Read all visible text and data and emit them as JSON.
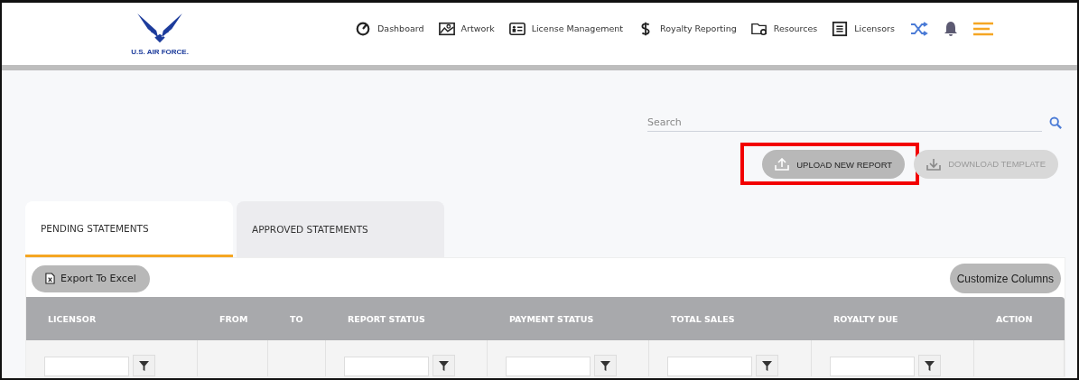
{
  "logo": {
    "text": "U.S. AIR FORCE."
  },
  "nav": [
    {
      "label": "Dashboard"
    },
    {
      "label": "Artwork"
    },
    {
      "label": "License Management"
    },
    {
      "label": "Royalty Reporting"
    },
    {
      "label": "Resources"
    },
    {
      "label": "Licensors"
    }
  ],
  "search": {
    "placeholder": "Search"
  },
  "actions": [
    {
      "label": "UPLOAD NEW REPORT",
      "disabled": false,
      "highlighted": true
    },
    {
      "label": "DOWNLOAD TEMPLATE",
      "disabled": true,
      "highlighted": false
    }
  ],
  "tabs": [
    {
      "label": "PENDING STATEMENTS",
      "selected": true
    },
    {
      "label": "APPROVED STATEMENTS",
      "selected": false
    }
  ],
  "toolbar": {
    "export": "Export To Excel",
    "customize": "Customize Columns"
  },
  "table": {
    "columns": [
      {
        "label": "LICENSOR",
        "filter": true
      },
      {
        "label": "FROM",
        "filter": false
      },
      {
        "label": "TO",
        "filter": false
      },
      {
        "label": "REPORT STATUS",
        "filter": true
      },
      {
        "label": "PAYMENT STATUS",
        "filter": true
      },
      {
        "label": "TOTAL SALES",
        "filter": true
      },
      {
        "label": "ROYALTY DUE",
        "filter": true
      },
      {
        "label": "ACTION",
        "filter": false
      }
    ]
  }
}
